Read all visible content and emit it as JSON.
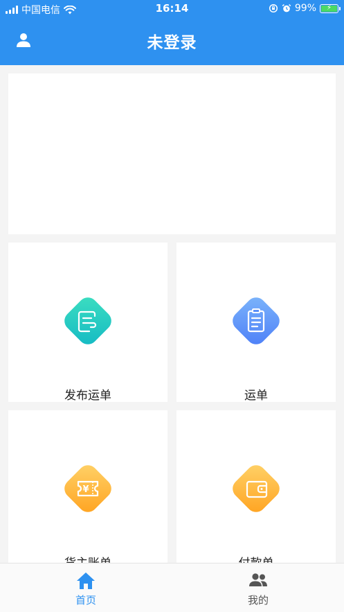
{
  "status_bar": {
    "carrier": "中国电信",
    "time": "16:14",
    "battery_percent": "99%",
    "battery_level": 0.99,
    "icons": [
      "signal-icon",
      "wifi-icon",
      "orientation-lock-icon",
      "alarm-icon",
      "battery-icon"
    ]
  },
  "header": {
    "title": "未登录",
    "left_icon": "user-icon",
    "background": "#2e91f0"
  },
  "grid": {
    "items": [
      {
        "label": "发布运单",
        "icon": "publish-waybill-icon",
        "gradient": [
          "#3ddfc0",
          "#14b9c4"
        ]
      },
      {
        "label": "运单",
        "icon": "waybill-icon",
        "gradient": [
          "#7db6fb",
          "#4c7ef7"
        ]
      },
      {
        "label": "货主账单",
        "icon": "owner-bill-icon",
        "gradient": [
          "#ffd36a",
          "#ffa21f"
        ]
      },
      {
        "label": "付款单",
        "icon": "payment-icon",
        "gradient": [
          "#ffd36a",
          "#ffa21f"
        ]
      }
    ]
  },
  "tabbar": {
    "tabs": [
      {
        "label": "首页",
        "icon": "home-icon",
        "active": true
      },
      {
        "label": "我的",
        "icon": "people-icon",
        "active": false
      }
    ],
    "active_color": "#2e91f0",
    "inactive_color": "#555555"
  }
}
